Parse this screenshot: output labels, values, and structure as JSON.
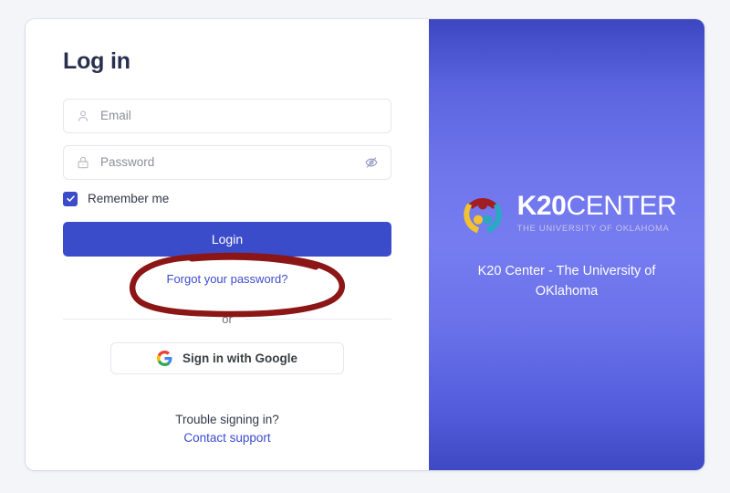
{
  "card": {
    "title": "Log in"
  },
  "form": {
    "email": {
      "placeholder": "Email",
      "value": "",
      "icon": "user-icon"
    },
    "password": {
      "placeholder": "Password",
      "value": "",
      "icon": "lock-icon",
      "toggle_icon": "eye-off-icon"
    },
    "remember": {
      "label": "Remember me",
      "checked": true
    },
    "login_button": "Login",
    "forgot_link": "Forgot your password?",
    "divider_text": "or",
    "google_button": {
      "label": "Sign in with Google",
      "icon": "google-icon"
    },
    "support": {
      "question": "Trouble signing in?",
      "link": "Contact support"
    }
  },
  "annotation": {
    "shape": "hand-drawn-ellipse",
    "target": "Forgot your password?",
    "color": "#8c1616"
  },
  "brand": {
    "wordmark_bold": "K20",
    "wordmark_light": "CENTER",
    "tagline": "THE UNIVERSITY OF OKLAHOMA",
    "caption": "K20 Center - The University of OKlahoma",
    "logo_colors": {
      "top": "#a01e24",
      "left": "#f2c230",
      "right": "#2aa8c4"
    }
  },
  "colors": {
    "page_background": "#f4f5f9",
    "card_background": "#ffffff",
    "primary": "#3b4cca",
    "link": "#3b4ccc",
    "title": "#28304d",
    "panel_gradient_edge": "#3c46c0",
    "panel_gradient_center": "#767cf0"
  }
}
